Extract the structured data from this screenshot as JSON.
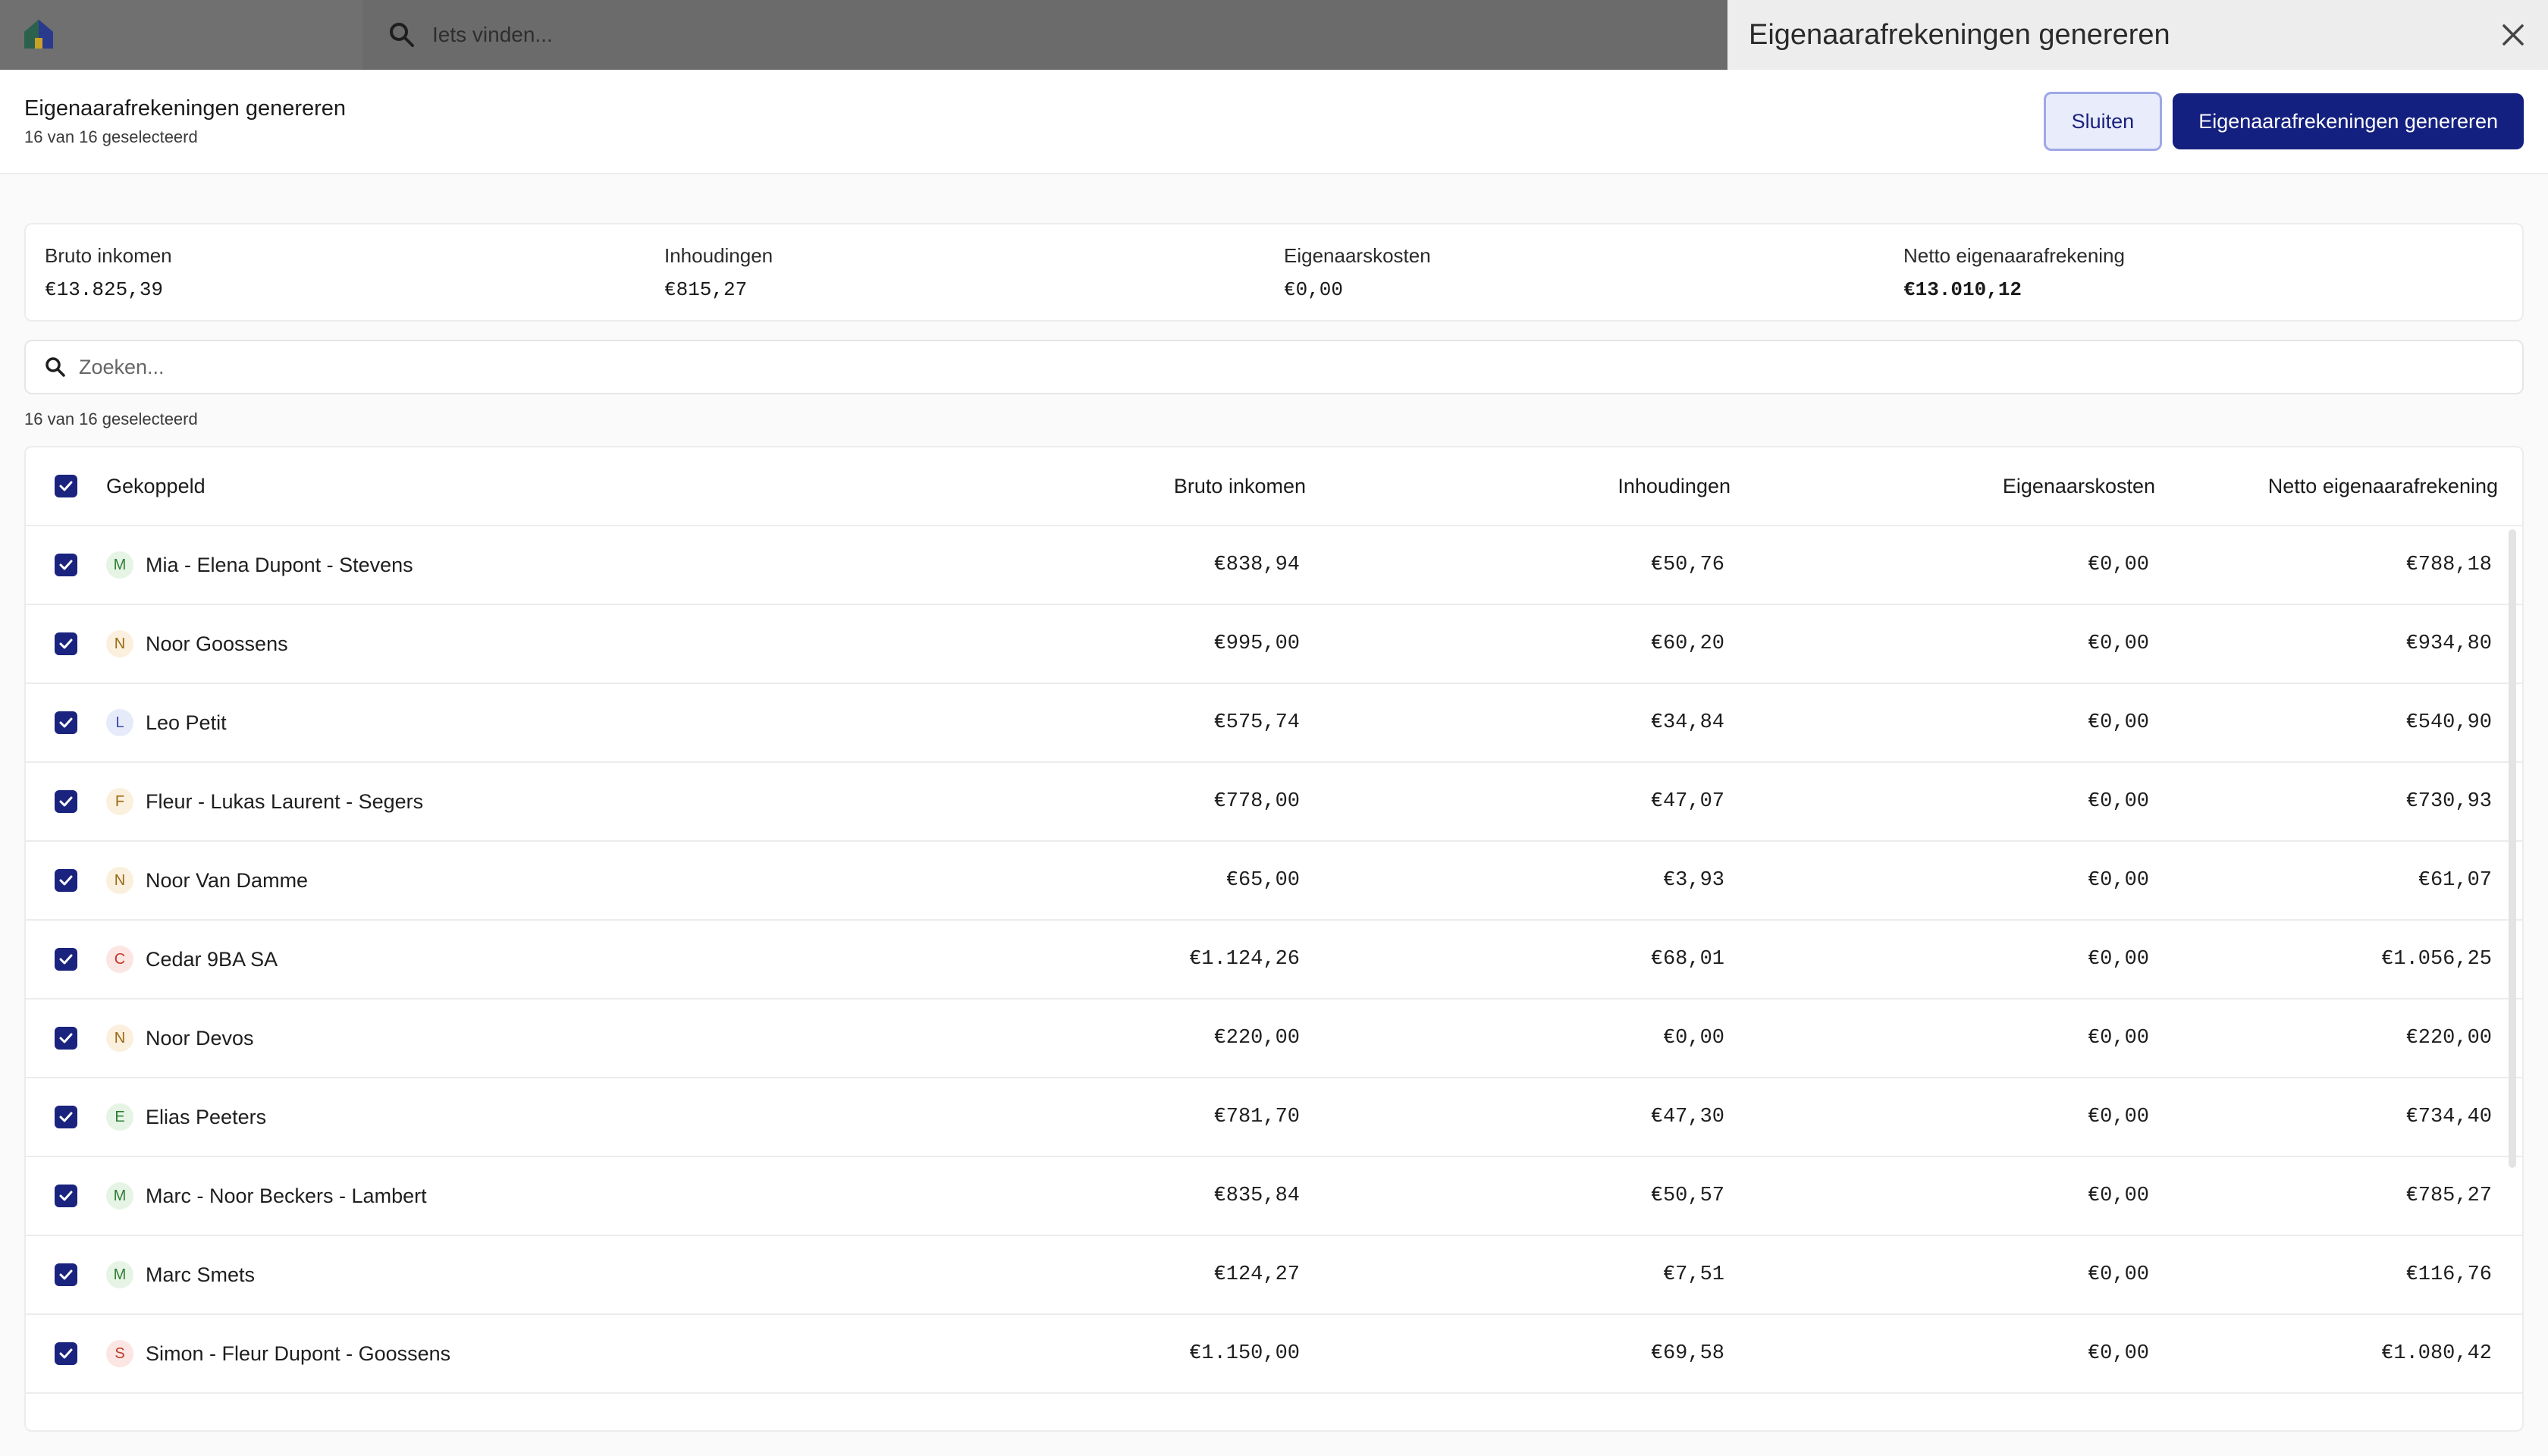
{
  "app": {
    "search_placeholder": "Iets vinden..."
  },
  "panel": {
    "title": "Eigenaarafrekeningen genereren"
  },
  "modal": {
    "title": "Eigenaarafrekeningen genereren",
    "subtitle": "16 van 16 geselecteerd",
    "close_label": "Sluiten",
    "generate_label": "Eigenaarafrekeningen genereren"
  },
  "summary": {
    "gross_label": "Bruto inkomen",
    "gross_value": "€13.825,39",
    "deductions_label": "Inhoudingen",
    "deductions_value": "€815,27",
    "costs_label": "Eigenaarskosten",
    "costs_value": "€0,00",
    "net_label": "Netto eigenaarafrekening",
    "net_value": "€13.010,12"
  },
  "search": {
    "placeholder": "Zoeken..."
  },
  "selection_count": "16 van 16 geselecteerd",
  "table": {
    "headers": {
      "linked": "Gekoppeld",
      "gross": "Bruto inkomen",
      "deductions": "Inhoudingen",
      "costs": "Eigenaarskosten",
      "net": "Netto eigenaarafrekening"
    },
    "rows": [
      {
        "initial": "M",
        "name": "Mia - Elena Dupont - Stevens",
        "gross": "€838,94",
        "deductions": "€50,76",
        "costs": "€0,00",
        "net": "€788,18",
        "avatar_bg": "#e6f4e6",
        "avatar_fg": "#2e7d32"
      },
      {
        "initial": "N",
        "name": "Noor Goossens",
        "gross": "€995,00",
        "deductions": "€60,20",
        "costs": "€0,00",
        "net": "€934,80",
        "avatar_bg": "#fbf0dd",
        "avatar_fg": "#9a6a16"
      },
      {
        "initial": "L",
        "name": "Leo Petit",
        "gross": "€575,74",
        "deductions": "€34,84",
        "costs": "€0,00",
        "net": "€540,90",
        "avatar_bg": "#e6ebfa",
        "avatar_fg": "#3949ab"
      },
      {
        "initial": "F",
        "name": "Fleur - Lukas Laurent - Segers",
        "gross": "€778,00",
        "deductions": "€47,07",
        "costs": "€0,00",
        "net": "€730,93",
        "avatar_bg": "#fbf0dd",
        "avatar_fg": "#9a6a16"
      },
      {
        "initial": "N",
        "name": "Noor Van Damme",
        "gross": "€65,00",
        "deductions": "€3,93",
        "costs": "€0,00",
        "net": "€61,07",
        "avatar_bg": "#fbf0dd",
        "avatar_fg": "#9a6a16"
      },
      {
        "initial": "C",
        "name": "Cedar 9BA SA",
        "gross": "€1.124,26",
        "deductions": "€68,01",
        "costs": "€0,00",
        "net": "€1.056,25",
        "avatar_bg": "#fbe6e4",
        "avatar_fg": "#c0392b"
      },
      {
        "initial": "N",
        "name": "Noor Devos",
        "gross": "€220,00",
        "deductions": "€0,00",
        "costs": "€0,00",
        "net": "€220,00",
        "avatar_bg": "#fbf0dd",
        "avatar_fg": "#9a6a16"
      },
      {
        "initial": "E",
        "name": "Elias Peeters",
        "gross": "€781,70",
        "deductions": "€47,30",
        "costs": "€0,00",
        "net": "€734,40",
        "avatar_bg": "#e6f4e6",
        "avatar_fg": "#2e7d32"
      },
      {
        "initial": "M",
        "name": "Marc - Noor Beckers - Lambert",
        "gross": "€835,84",
        "deductions": "€50,57",
        "costs": "€0,00",
        "net": "€785,27",
        "avatar_bg": "#e6f4e6",
        "avatar_fg": "#2e7d32"
      },
      {
        "initial": "M",
        "name": "Marc Smets",
        "gross": "€124,27",
        "deductions": "€7,51",
        "costs": "€0,00",
        "net": "€116,76",
        "avatar_bg": "#e6f4e6",
        "avatar_fg": "#2e7d32"
      },
      {
        "initial": "S",
        "name": "Simon - Fleur Dupont - Goossens",
        "gross": "€1.150,00",
        "deductions": "€69,58",
        "costs": "€0,00",
        "net": "€1.080,42",
        "avatar_bg": "#fbe6e4",
        "avatar_fg": "#c0392b"
      }
    ]
  },
  "colors": {
    "primary": "#14207f",
    "checkbox": "#1a237e",
    "secondary_bg": "#e9ecfb"
  }
}
